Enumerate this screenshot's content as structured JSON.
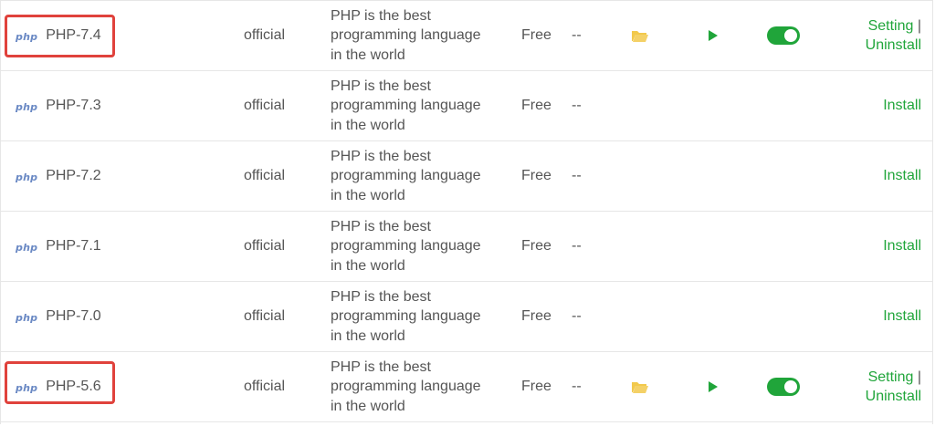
{
  "colors": {
    "accent": "#20a53a",
    "highlight_border": "#e0423c",
    "folder": "#f2c94c",
    "php_logo": "#6a89c4"
  },
  "icons": {
    "logo": "php-logo-icon",
    "folder": "folder-open-icon",
    "play": "play-icon",
    "toggle": "toggle-switch-on"
  },
  "plugins": [
    {
      "logo": "php",
      "name": "PHP-7.4",
      "type": "official",
      "description": [
        "PHP is the best",
        "programming language",
        "in the world"
      ],
      "price": "Free",
      "expire": "--",
      "installed": true,
      "highlighted": true,
      "actions": [
        "Setting",
        "Uninstall"
      ],
      "separator": "|"
    },
    {
      "logo": "php",
      "name": "PHP-7.3",
      "type": "official",
      "description": [
        "PHP is the best",
        "programming language",
        "in the world"
      ],
      "price": "Free",
      "expire": "--",
      "installed": false,
      "highlighted": false,
      "actions": [
        "Install"
      ]
    },
    {
      "logo": "php",
      "name": "PHP-7.2",
      "type": "official",
      "description": [
        "PHP is the best",
        "programming language",
        "in the world"
      ],
      "price": "Free",
      "expire": "--",
      "installed": false,
      "highlighted": false,
      "actions": [
        "Install"
      ]
    },
    {
      "logo": "php",
      "name": "PHP-7.1",
      "type": "official",
      "description": [
        "PHP is the best",
        "programming language",
        "in the world"
      ],
      "price": "Free",
      "expire": "--",
      "installed": false,
      "highlighted": false,
      "actions": [
        "Install"
      ]
    },
    {
      "logo": "php",
      "name": "PHP-7.0",
      "type": "official",
      "description": [
        "PHP is the best",
        "programming language",
        "in the world"
      ],
      "price": "Free",
      "expire": "--",
      "installed": false,
      "highlighted": false,
      "actions": [
        "Install"
      ]
    },
    {
      "logo": "php",
      "name": "PHP-5.6",
      "type": "official",
      "description": [
        "PHP is the best",
        "programming language",
        "in the world"
      ],
      "price": "Free",
      "expire": "--",
      "installed": true,
      "highlighted": true,
      "actions": [
        "Setting",
        "Uninstall"
      ],
      "separator": "|"
    }
  ]
}
